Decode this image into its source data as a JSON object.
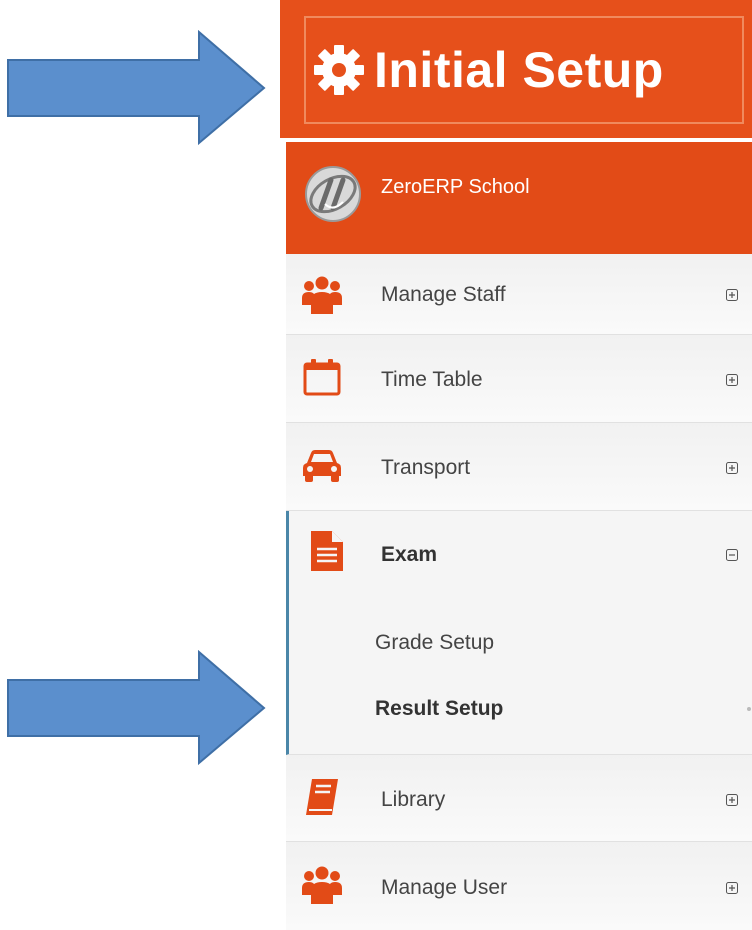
{
  "banner": {
    "title": "Initial Setup",
    "icon": "gear-icon",
    "color": "#e6501b"
  },
  "brand": {
    "name": "ZeroERP School",
    "logo": "zeroerp-logo",
    "color": "#e24b17"
  },
  "menu": [
    {
      "label": "Manage Staff",
      "icon": "users-icon",
      "state": "collapsed"
    },
    {
      "label": "Time Table",
      "icon": "calendar-icon",
      "state": "collapsed"
    },
    {
      "label": "Transport",
      "icon": "car-icon",
      "state": "collapsed"
    },
    {
      "label": "Exam",
      "icon": "document-icon",
      "state": "expanded",
      "children": [
        {
          "label": "Grade Setup"
        },
        {
          "label": "Result Setup",
          "active": true
        }
      ]
    },
    {
      "label": "Library",
      "icon": "book-icon",
      "state": "collapsed"
    },
    {
      "label": "Manage User",
      "icon": "users-icon",
      "state": "collapsed"
    }
  ],
  "annotations": {
    "arrow_color": "#5b8fcd",
    "arrows": [
      "arrow-to-initial-setup",
      "arrow-to-result-setup"
    ]
  },
  "accent_color": "#e24b17"
}
